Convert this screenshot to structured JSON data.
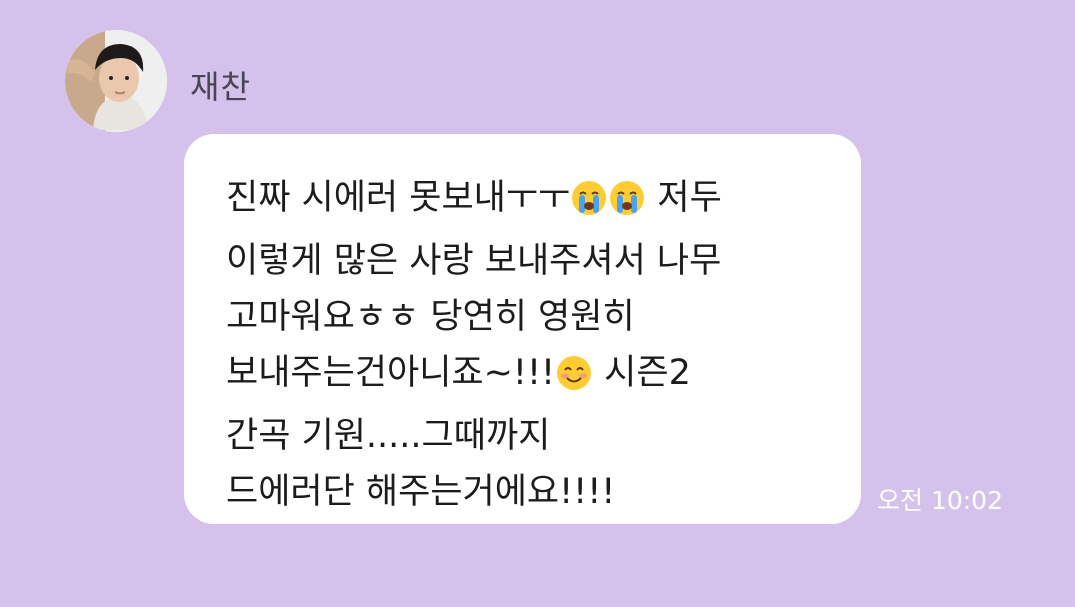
{
  "sender": {
    "name": "재찬",
    "avatar_icon": "profile-photo"
  },
  "message": {
    "line1_a": "진짜 시에러 못보내ㅜㅜ",
    "line1_b": "저두",
    "line2": "이렇게 많은 사랑 보내주셔서 나무",
    "line3": "고마워요ㅎㅎ 당연히 영원히",
    "line4_a": "보내주는건아니죠~!!!",
    "line4_b": "시즌2",
    "line5": "간곡 기원.....그때까지",
    "line6": "드에러단 해주는거에요!!!!",
    "emojis": [
      "loudly-crying-face-icon",
      "loudly-crying-face-icon",
      "smiling-face-icon"
    ]
  },
  "timestamp": "오전 10:02",
  "colors": {
    "background": "#d5c2ec",
    "bubble": "#ffffff",
    "timestamp": "#ffffff"
  }
}
